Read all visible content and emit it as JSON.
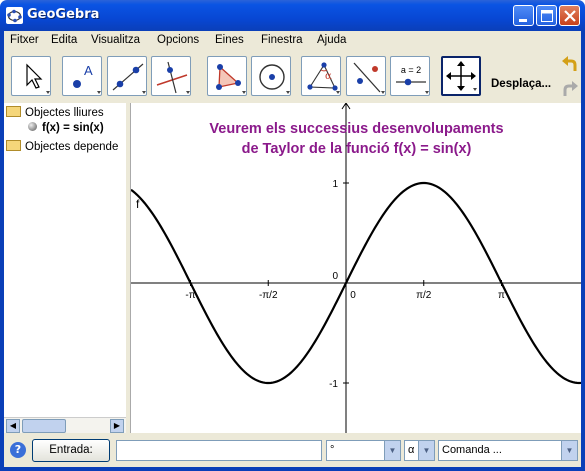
{
  "window": {
    "title": "GeoGebra"
  },
  "menu": [
    "Fitxer",
    "Edita",
    "Visualitza",
    "Opcions",
    "Eines",
    "Finestra",
    "Ajuda"
  ],
  "toolbar": {
    "tools": [
      "move",
      "point",
      "line-through-two-points",
      "perpendicular-line",
      "polygon",
      "circle",
      "angle",
      "reflect",
      "slider",
      "move-graphics-view"
    ],
    "slider_tool_text": "a = 2",
    "mode_label": "Desplaça..."
  },
  "algebra": {
    "free_objects_label": "Objectes lliures",
    "function_entry": "f(x) = sin(x)",
    "dependent_objects_label": "Objectes depende"
  },
  "graphics": {
    "caption_line1": "Veurem els successius desenvolupaments",
    "caption_line2": "de Taylor de la funció  f(x) = sin(x)",
    "curve_label": "f",
    "x_tick_labels": [
      "-π",
      "-π/2",
      "0",
      "π/2",
      "π"
    ],
    "y_tick_labels": [
      "1",
      "0",
      "-1"
    ],
    "caption_color": "#8b1a8b"
  },
  "inputbar": {
    "entrada_label": "Entrada:",
    "input_value": "",
    "degree_symbol": "°",
    "alpha_symbol": "α",
    "command_placeholder": "Comanda ..."
  }
}
